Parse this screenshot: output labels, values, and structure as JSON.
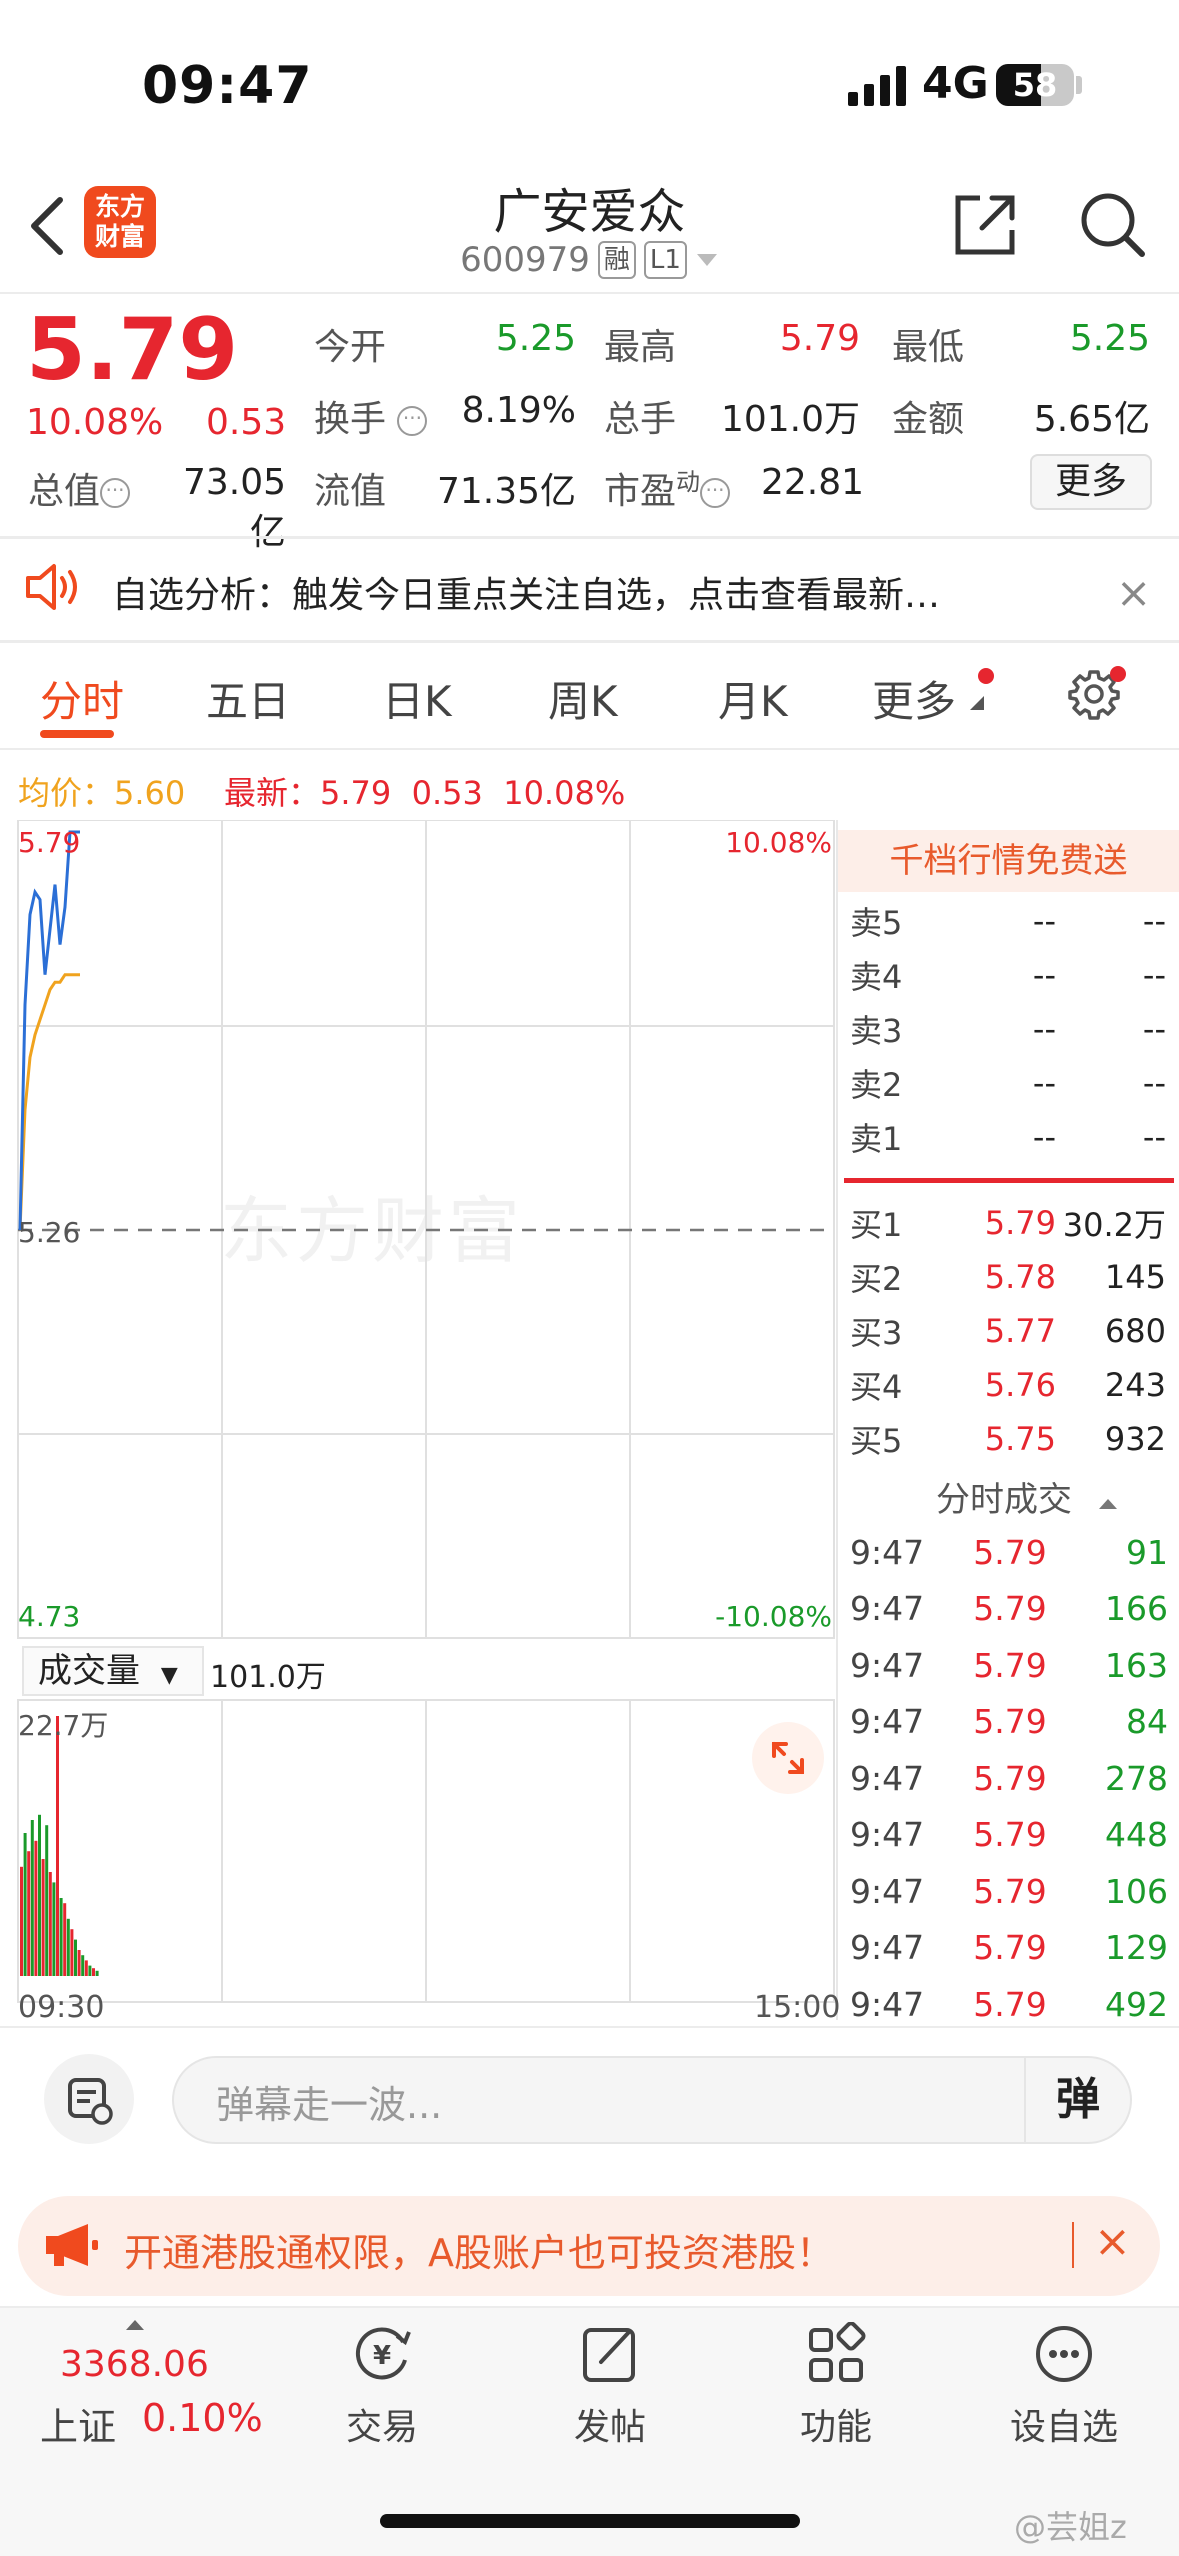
{
  "status": {
    "time": "09:47",
    "network": "4G",
    "battery": "58",
    "battery_level": 0.58
  },
  "header": {
    "logo_line1": "东方",
    "logo_line2": "财富",
    "name": "广安爱众",
    "code": "600979",
    "tag1": "融",
    "tag2": "L1"
  },
  "quote": {
    "price": "5.79",
    "change_pct": "10.08%",
    "change_abs": "0.53",
    "open_label": "今开",
    "open": "5.25",
    "high_label": "最高",
    "high": "5.79",
    "low_label": "最低",
    "low": "5.25",
    "turnover_label": "换手",
    "turnover": "8.19%",
    "volume_label": "总手",
    "volume": "101.0万",
    "amount_label": "金额",
    "amount": "5.65亿",
    "mktcap_label": "总值",
    "mktcap": "73.05亿",
    "float_label": "流值",
    "float": "71.35亿",
    "pe_label": "市盈",
    "pe_sup": "动",
    "pe": "22.81",
    "more_label": "更多"
  },
  "notice": {
    "text": "自选分析：触发今日重点关注自选，点击查看最新…",
    "close": "×"
  },
  "tabs": [
    "分时",
    "五日",
    "日K",
    "周K",
    "月K",
    "更多"
  ],
  "summary": {
    "avg_label": "均价：",
    "avg": "5.60",
    "last_label": "最新：",
    "last": "5.79",
    "chg": "0.53",
    "pct": "10.08%"
  },
  "chart": {
    "y_top": "5.79",
    "y_mid": "5.26",
    "y_bottom": "4.73",
    "pct_top": "10.08%",
    "pct_bottom": "-10.08%",
    "watermark": "东方财富",
    "prev_close": 5.26,
    "y_min": 4.73,
    "y_max": 5.79,
    "price_series": [
      5.26,
      5.56,
      5.68,
      5.71,
      5.7,
      5.6,
      5.66,
      5.72,
      5.64,
      5.69,
      5.79,
      5.79,
      5.79
    ],
    "avg_series": [
      5.26,
      5.42,
      5.49,
      5.52,
      5.54,
      5.56,
      5.58,
      5.59,
      5.59,
      5.6,
      5.6,
      5.6,
      5.6
    ],
    "price_color": "#2b6fd6",
    "avg_color": "#f0a31e"
  },
  "orderbook": {
    "promo": "千档行情免费送",
    "asks": [
      {
        "label": "卖5",
        "price": "--",
        "vol": "--"
      },
      {
        "label": "卖4",
        "price": "--",
        "vol": "--"
      },
      {
        "label": "卖3",
        "price": "--",
        "vol": "--"
      },
      {
        "label": "卖2",
        "price": "--",
        "vol": "--"
      },
      {
        "label": "卖1",
        "price": "--",
        "vol": "--"
      }
    ],
    "bids": [
      {
        "label": "买1",
        "price": "5.79",
        "vol": "30.2万"
      },
      {
        "label": "买2",
        "price": "5.78",
        "vol": "145"
      },
      {
        "label": "买3",
        "price": "5.77",
        "vol": "680"
      },
      {
        "label": "买4",
        "price": "5.76",
        "vol": "243"
      },
      {
        "label": "买5",
        "price": "5.75",
        "vol": "932"
      }
    ]
  },
  "ticks": {
    "title": "分时成交",
    "rows": [
      {
        "time": "9:47",
        "price": "5.79",
        "vol": "91"
      },
      {
        "time": "9:47",
        "price": "5.79",
        "vol": "166"
      },
      {
        "time": "9:47",
        "price": "5.79",
        "vol": "163"
      },
      {
        "time": "9:47",
        "price": "5.79",
        "vol": "84"
      },
      {
        "time": "9:47",
        "price": "5.79",
        "vol": "278"
      },
      {
        "time": "9:47",
        "price": "5.79",
        "vol": "448"
      },
      {
        "time": "9:47",
        "price": "5.79",
        "vol": "106"
      },
      {
        "time": "9:47",
        "price": "5.79",
        "vol": "129"
      },
      {
        "time": "9:47",
        "price": "5.79",
        "vol": "492"
      }
    ]
  },
  "volume": {
    "selector": "成交量",
    "total": "101.0万",
    "max_label": "22.7万",
    "bars": [
      0.42,
      0.55,
      0.48,
      0.6,
      0.52,
      0.62,
      0.45,
      0.58,
      0.4,
      0.36,
      1.0,
      0.3,
      0.28,
      0.22,
      0.18,
      0.14,
      0.1,
      0.08,
      0.06,
      0.04,
      0.03,
      0.02
    ],
    "bar_colors": [
      "r",
      "g",
      "r",
      "g",
      "r",
      "g",
      "r",
      "g",
      "r",
      "g",
      "r",
      "g",
      "r",
      "g",
      "r",
      "g",
      "r",
      "g",
      "r",
      "g",
      "r",
      "g"
    ],
    "t_start": "09:30",
    "t_end": "15:00"
  },
  "danmu": {
    "placeholder": "弹幕走一波...",
    "send": "弹"
  },
  "promo": {
    "text": "开通港股通权限，A股账户也可投资港股！",
    "close": "×"
  },
  "nav": {
    "index_value": "3368.06",
    "index_name": "上证",
    "index_pct": "0.10%",
    "items": [
      {
        "label": "交易",
        "icon": "yuan-icon"
      },
      {
        "label": "发帖",
        "icon": "edit-icon"
      },
      {
        "label": "功能",
        "icon": "grid-icon"
      },
      {
        "label": "设自选",
        "icon": "more-icon"
      }
    ]
  },
  "watermark_user": "@芸姐z"
}
